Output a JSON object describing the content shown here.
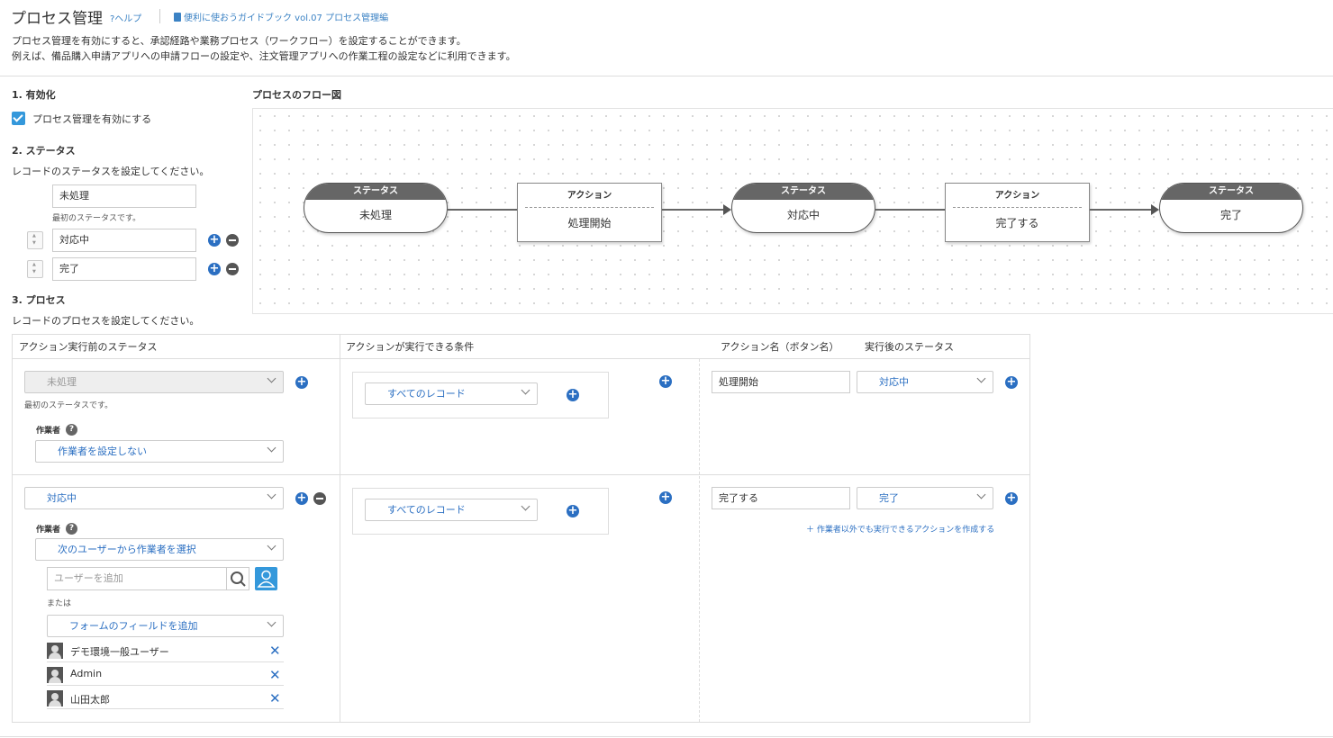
{
  "header": {
    "title": "プロセス管理",
    "help_label": "?ヘルプ",
    "guide_link": "便利に使おうガイドブック vol.07 プロセス管理編",
    "desc_line1": "プロセス管理を有効にすると、承認経路や業務プロセス（ワークフロー）を設定することができます。",
    "desc_line2": "例えば、備品購入申請アプリへの申請フローの設定や、注文管理アプリへの作業工程の設定などに利用できます。"
  },
  "enable": {
    "heading": "1. 有効化",
    "checkbox_label": "プロセス管理を有効にする",
    "checked": true
  },
  "status": {
    "heading": "2. ステータス",
    "desc": "レコードのステータスを設定してください。",
    "items": [
      "未処理",
      "対応中",
      "完了"
    ],
    "first_note": "最初のステータスです。"
  },
  "process": {
    "heading": "3. プロセス",
    "desc": "レコードのプロセスを設定してください。"
  },
  "flow": {
    "heading": "プロセスのフロー図",
    "status_label": "ステータス",
    "action_label": "アクション",
    "nodes": [
      "未処理",
      "処理開始",
      "対応中",
      "完了する",
      "完了"
    ]
  },
  "table": {
    "col_before": "アクション実行前のステータス",
    "col_condition": "アクションが実行できる条件",
    "col_action_name": "アクション名（ボタン名）",
    "col_after": "実行後のステータス",
    "assignee_label": "作業者",
    "row1": {
      "status": "未処理",
      "note": "最初のステータスです。",
      "assignee_select": "作業者を設定しない",
      "condition": "すべてのレコード",
      "action_name": "処理開始",
      "next_status": "対応中"
    },
    "row2": {
      "status": "対応中",
      "assignee_select": "次のユーザーから作業者を選択",
      "user_placeholder": "ユーザーを追加",
      "or_label": "または",
      "field_select": "フォームのフィールドを追加",
      "users": [
        "デモ環境一般ユーザー",
        "Admin",
        "山田太郎"
      ],
      "condition": "すべてのレコード",
      "action_name": "完了する",
      "next_status": "完了",
      "extra_link": "作業者以外でも実行できるアクションを作成する"
    }
  }
}
